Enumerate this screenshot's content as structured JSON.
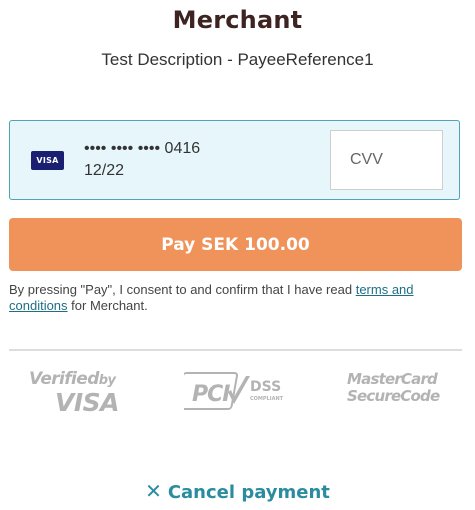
{
  "header": {
    "merchant_name": "Merchant",
    "description": "Test Description - PayeeReference1"
  },
  "card": {
    "brand": "VISA",
    "brand_icon": "visa-card-icon",
    "masked_number": "•••• •••• •••• 0416",
    "expiry": "12/22",
    "cvv_placeholder": "CVV",
    "cvv_value": ""
  },
  "pay_button": {
    "label": "Pay SEK 100.00"
  },
  "consent": {
    "prefix": "By pressing \"Pay\", I consent to and confirm that I have read ",
    "link_text": "terms and conditions",
    "suffix": " for Merchant."
  },
  "security_logos": {
    "verified_by_visa": {
      "line1": "Verified",
      "line1_small": "by",
      "line2": "VISA"
    },
    "pci_dss": {
      "mark": "PCI",
      "text": "DSS",
      "subtext": "COMPLIANT"
    },
    "mastercard_securecode": {
      "line1": "MasterCard",
      "line2": "SecureCode"
    },
    "logo_color": "#b3b3b3"
  },
  "cancel": {
    "icon": "close-icon",
    "label": "Cancel payment"
  },
  "colors": {
    "title": "#3d2322",
    "card_box_bg": "#e7f6fa",
    "card_box_border": "#4fa3b4",
    "pay_button_bg": "#f0935a",
    "link": "#1d6f86",
    "cancel": "#2a8c9e",
    "visa_brand": "#1a1f71"
  }
}
